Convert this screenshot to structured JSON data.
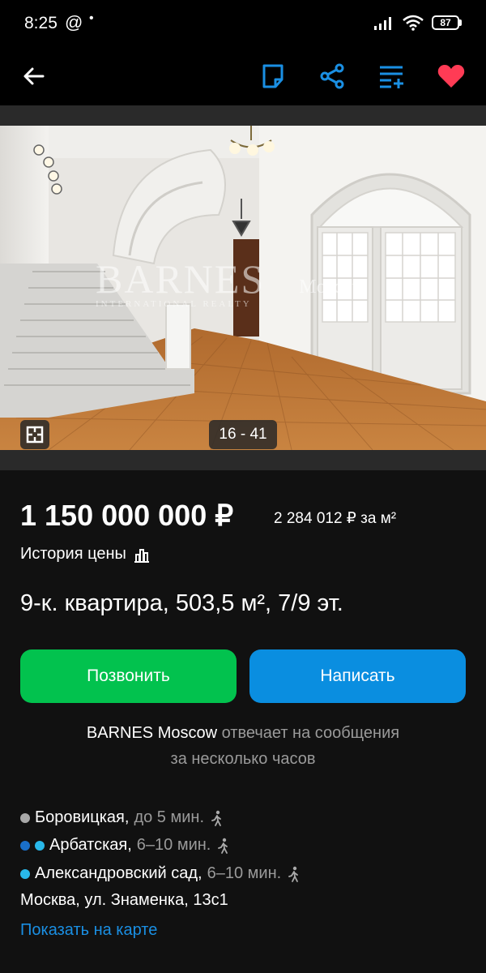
{
  "status_bar": {
    "time": "8:25",
    "at_symbol": "@",
    "dot": "•",
    "battery": "87"
  },
  "toolbar": {
    "back_icon": "arrow-left-icon",
    "note_icon": "note-icon",
    "share_icon": "share-icon",
    "compare_icon": "compare-list-icon",
    "favorite_icon": "heart-icon",
    "accent_color": "#1a8fe3",
    "favorite_color": "#ff3b55"
  },
  "photo": {
    "counter": "16 - 41",
    "plan_icon": "floor-plan-icon",
    "watermark_brand": "BARNES",
    "watermark_sub": "INTERNATIONAL REALTY",
    "watermark_city": "Moscow"
  },
  "listing": {
    "price": "1 150 000 000 ₽",
    "price_per_m2": "2 284 012 ₽ за м²",
    "price_history_label": "История цены",
    "title": "9-к. квартира, 503,5 м², 7/9 эт."
  },
  "actions": {
    "call_label": "Позвонить",
    "call_color": "#02c24e",
    "write_label": "Написать",
    "write_color": "#0a8ee0"
  },
  "seller": {
    "name": "BARNES Moscow",
    "response_part1": "отвечает на сообщения",
    "response_part2": "за несколько часов"
  },
  "metro": [
    {
      "name": "Боровицкая,",
      "time": "до 5 мин.",
      "colors": [
        "#a8a8a8"
      ]
    },
    {
      "name": "Арбатская,",
      "time": "6–10 мин.",
      "colors": [
        "#1a6fc9",
        "#29b8ea"
      ]
    },
    {
      "name": "Александровский сад,",
      "time": "6–10 мин.",
      "colors": [
        "#29b8ea"
      ]
    }
  ],
  "address": "Москва, ул. Знаменка, 13с1",
  "map_link": "Показать на карте"
}
